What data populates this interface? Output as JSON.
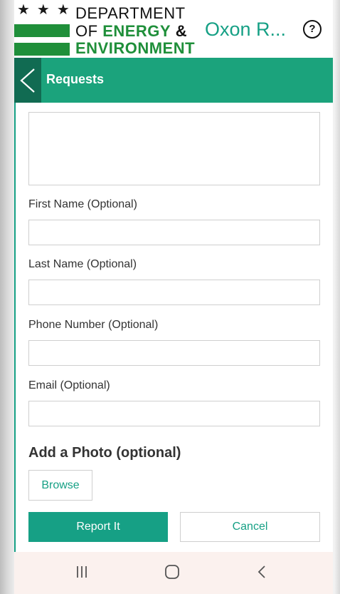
{
  "header": {
    "logo_line1": "DEPARTMENT",
    "logo_line2_prefix": "OF",
    "logo_line2_emphasis": "ENERGY",
    "logo_line2_suffix": "&",
    "logo_line3": "ENVIRONMENT",
    "app_title": "Oxon R...",
    "help_icon": "question-circle-icon"
  },
  "toolbar": {
    "back_icon": "chevron-left-icon",
    "title": "Requests"
  },
  "form": {
    "fields": [
      {
        "label": "First Name (Optional)",
        "value": ""
      },
      {
        "label": "Last Name (Optional)",
        "value": ""
      },
      {
        "label": "Phone Number (Optional)",
        "value": ""
      },
      {
        "label": "Email (Optional)",
        "value": ""
      }
    ],
    "photo_title": "Add a Photo (optional)",
    "browse_label": "Browse",
    "report_label": "Report It",
    "cancel_label": "Cancel"
  },
  "navbar": {
    "recents_icon": "recent-apps-icon",
    "home_icon": "home-icon",
    "back_icon": "back-icon"
  },
  "colors": {
    "accent": "#16a085",
    "toolbar": "#1ba37c",
    "back_button": "#116b52",
    "logo_green": "#1f8f3a"
  }
}
